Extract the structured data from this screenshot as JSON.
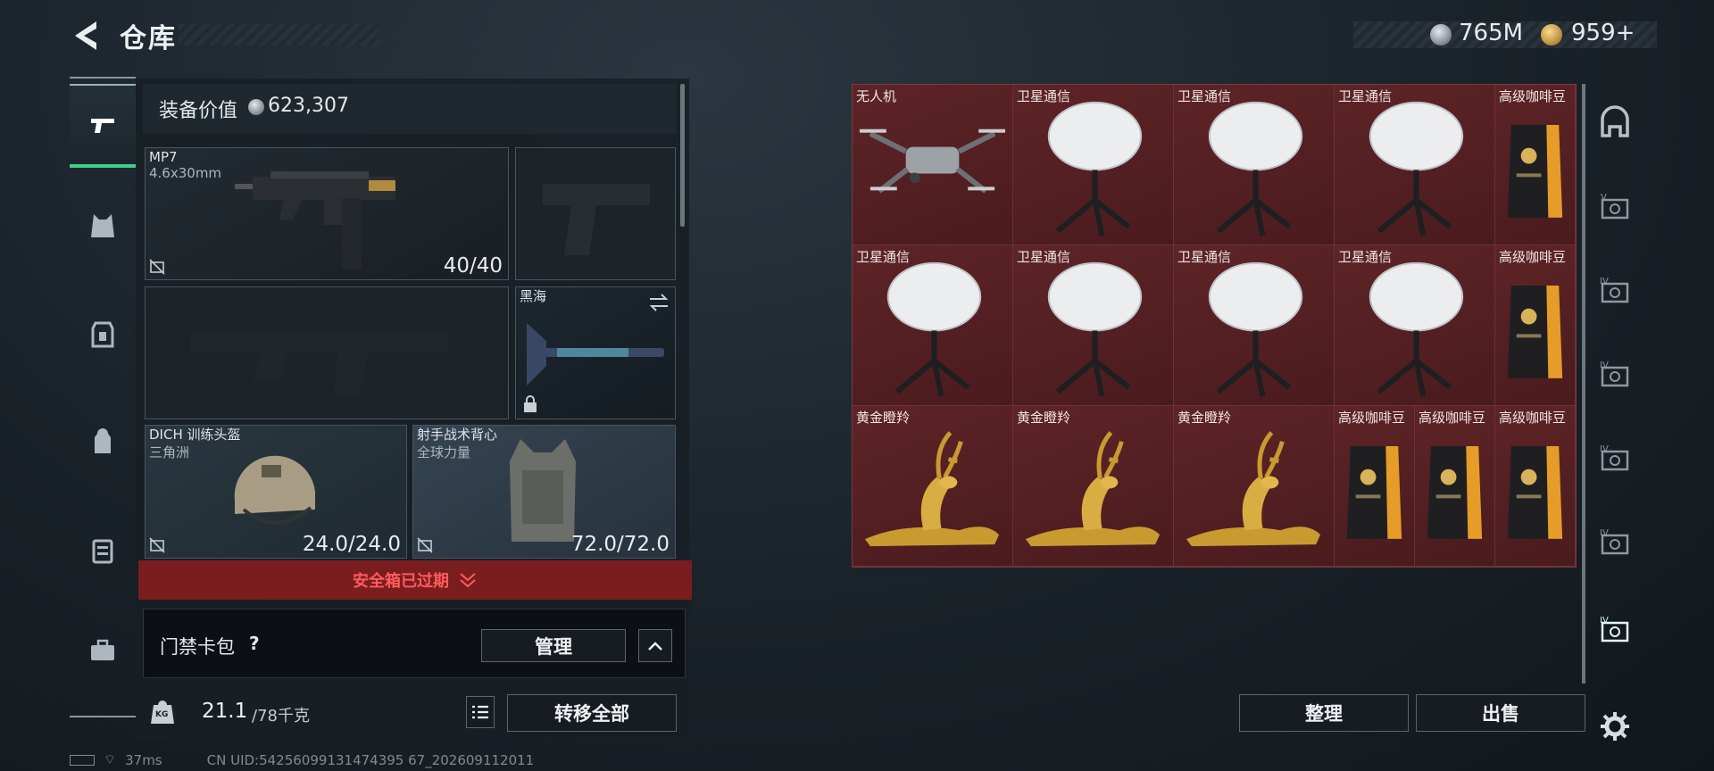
{
  "header": {
    "title": "仓库",
    "silver_amount": "765M",
    "gold_amount": "959+"
  },
  "equipment": {
    "value_label": "装备价值",
    "value": "623,307",
    "primary_weapon": {
      "name": "MP7",
      "caliber": "4.6x30mm",
      "ammo": "40/40"
    },
    "melee": {
      "name": "黑海"
    },
    "helmet": {
      "name": "DICH 训练头盔",
      "brand": "三角洲",
      "durability": "24.0/24.0"
    },
    "armor": {
      "name": "射手战术背心",
      "brand": "全球力量",
      "durability": "72.0/72.0"
    },
    "safebox_status": "安全箱已过期"
  },
  "keycard": {
    "label": "门禁卡包",
    "help": "?",
    "manage_label": "管理"
  },
  "weight": {
    "current": "21.1",
    "max": "/78千克",
    "transfer_all_label": "转移全部",
    "kg_icon_label": "KG"
  },
  "status_bar": {
    "ping": "37ms",
    "uid": "CN UID:54256099131474395 67_202609112011"
  },
  "inventory": {
    "items": [
      {
        "name": "无人机",
        "type": "drone"
      },
      {
        "name": "卫星通信",
        "type": "dish"
      },
      {
        "name": "卫星通信",
        "type": "dish"
      },
      {
        "name": "卫星通信",
        "type": "dish"
      },
      {
        "name": "高级咖啡豆",
        "type": "coffee"
      },
      {
        "name": "卫星通信",
        "type": "dish"
      },
      {
        "name": "卫星通信",
        "type": "dish"
      },
      {
        "name": "卫星通信",
        "type": "dish"
      },
      {
        "name": "卫星通信",
        "type": "dish"
      },
      {
        "name": "高级咖啡豆",
        "type": "coffee"
      },
      {
        "name": "黄金瞪羚",
        "type": "gazelle"
      },
      {
        "name": "黄金瞪羚",
        "type": "gazelle"
      },
      {
        "name": "黄金瞪羚",
        "type": "gazelle"
      },
      {
        "name": "高级咖啡豆",
        "type": "coffee"
      },
      {
        "name": "高级咖啡豆",
        "type": "coffee"
      },
      {
        "name": "高级咖啡豆",
        "type": "coffee"
      }
    ],
    "sort_label": "整理",
    "sell_label": "出售"
  },
  "right_tabs": [
    "storage-icon",
    "case-v-icon",
    "case-iv-icon",
    "case-iv-icon",
    "case-iv-icon",
    "case-iv-icon",
    "case-iv-icon",
    "settings-icon"
  ],
  "colors": {
    "accent_green": "#3fd08a",
    "danger_red": "#ff5c5c",
    "grid_red": "#552225"
  }
}
